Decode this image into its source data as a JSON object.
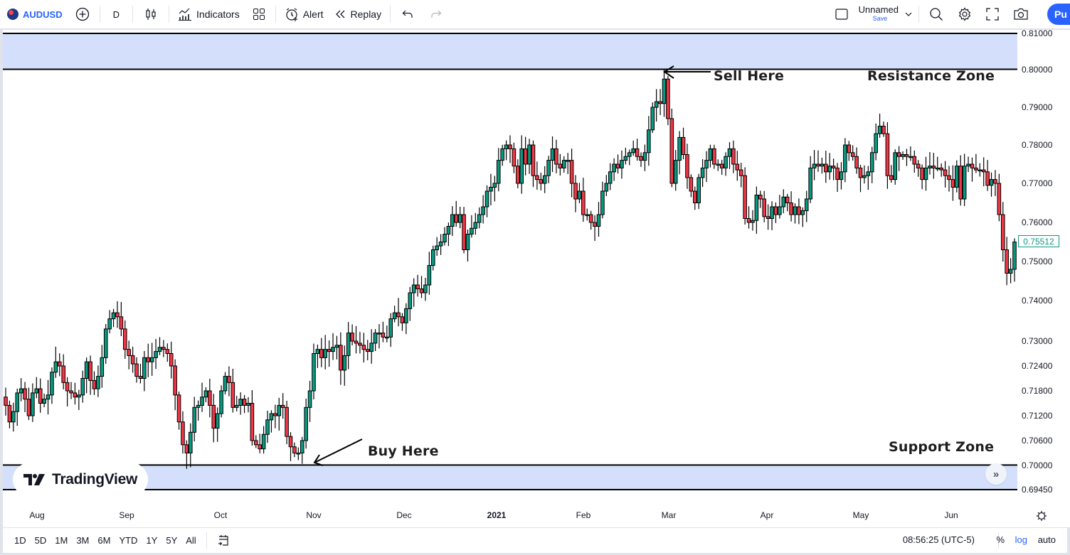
{
  "topbar": {
    "symbol": "AUDUSD",
    "interval": "D",
    "indicators_label": "Indicators",
    "alert_label": "Alert",
    "replay_label": "Replay",
    "layout_name": "Unnamed",
    "layout_save": "Save",
    "publish_label": "Pu",
    "icons": [
      "flag-icon",
      "add-symbol-icon",
      "candle-type-icon",
      "indicators-icon",
      "templates-icon",
      "alert-icon",
      "replay-icon",
      "undo-icon",
      "redo-icon",
      "layout-square-icon",
      "chevron-down-icon",
      "search-icon",
      "settings-icon",
      "fullscreen-icon",
      "camera-icon"
    ]
  },
  "annotations": {
    "sell": "Sell Here",
    "buy": "Buy Here",
    "resistance": "Resistance Zone",
    "support": "Support Zone",
    "logo": "TradingView"
  },
  "price_axis": {
    "last_price": "0.75512",
    "last_price_color": "#089981"
  },
  "bottombar": {
    "ranges": [
      "1D",
      "5D",
      "1M",
      "3M",
      "6M",
      "YTD",
      "1Y",
      "5Y",
      "All"
    ],
    "clock": "08:56:25 (UTC-5)",
    "percent": "%",
    "log": "log",
    "auto": "auto"
  },
  "colors": {
    "up": "#089981",
    "down": "#f23645",
    "zone": "#d4e0fb",
    "accent": "#2962ff"
  },
  "chart_data": {
    "type": "candlestick",
    "title": "AUDUSD D",
    "scale": "log",
    "y_ticks": [
      "0.81000",
      "0.80000",
      "0.79000",
      "0.78000",
      "0.77000",
      "0.76000",
      "0.75000",
      "0.74000",
      "0.73000",
      "0.72400",
      "0.71800",
      "0.71200",
      "0.70600",
      "0.70000",
      "0.69450"
    ],
    "y_tick_values": [
      0.81,
      0.8,
      0.79,
      0.78,
      0.77,
      0.76,
      0.75,
      0.74,
      0.73,
      0.724,
      0.718,
      0.712,
      0.706,
      0.7,
      0.6945
    ],
    "x_ticks": [
      "Aug",
      "Sep",
      "Oct",
      "Nov",
      "Dec",
      "2021",
      "Feb",
      "Mar",
      "Apr",
      "May",
      "Jun"
    ],
    "x_tick_candle_index": [
      7,
      29,
      51,
      74,
      96,
      118,
      140,
      160,
      183,
      206,
      228
    ],
    "zones": [
      {
        "name": "Resistance Zone",
        "low": 0.8001,
        "high": 0.81
      },
      {
        "name": "Support Zone",
        "low": 0.6945,
        "high": 0.7001
      }
    ],
    "last_price": 0.75512,
    "closes": [
      0.7145,
      0.7105,
      0.713,
      0.7175,
      0.7185,
      0.716,
      0.712,
      0.7175,
      0.7185,
      0.715,
      0.716,
      0.717,
      0.7225,
      0.725,
      0.724,
      0.72,
      0.718,
      0.7175,
      0.7165,
      0.717,
      0.721,
      0.725,
      0.7205,
      0.7185,
      0.7215,
      0.726,
      0.733,
      0.7355,
      0.737,
      0.736,
      0.733,
      0.728,
      0.7265,
      0.7245,
      0.7215,
      0.721,
      0.726,
      0.725,
      0.726,
      0.7275,
      0.7285,
      0.728,
      0.727,
      0.724,
      0.717,
      0.7105,
      0.705,
      0.703,
      0.708,
      0.714,
      0.7145,
      0.7165,
      0.718,
      0.7145,
      0.709,
      0.7125,
      0.718,
      0.7215,
      0.72,
      0.714,
      0.7145,
      0.716,
      0.7145,
      0.715,
      0.706,
      0.705,
      0.704,
      0.7075,
      0.711,
      0.7125,
      0.712,
      0.7145,
      0.714,
      0.707,
      0.7045,
      0.703,
      0.703,
      0.706,
      0.714,
      0.718,
      0.727,
      0.728,
      0.726,
      0.728,
      0.7275,
      0.7285,
      0.729,
      0.723,
      0.7265,
      0.732,
      0.73,
      0.7295,
      0.729,
      0.728,
      0.7275,
      0.7295,
      0.732,
      0.732,
      0.731,
      0.731,
      0.7355,
      0.737,
      0.736,
      0.7345,
      0.738,
      0.742,
      0.744,
      0.743,
      0.742,
      0.744,
      0.749,
      0.753,
      0.754,
      0.755,
      0.757,
      0.759,
      0.762,
      0.76,
      0.762,
      0.753,
      0.757,
      0.7585,
      0.76,
      0.762,
      0.764,
      0.768,
      0.769,
      0.77,
      0.776,
      0.779,
      0.78,
      0.779,
      0.7745,
      0.77,
      0.779,
      0.775,
      0.78,
      0.772,
      0.771,
      0.77,
      0.772,
      0.776,
      0.779,
      0.775,
      0.774,
      0.776,
      0.776,
      0.77,
      0.766,
      0.768,
      0.762,
      0.762,
      0.76,
      0.759,
      0.762,
      0.768,
      0.77,
      0.773,
      0.775,
      0.774,
      0.776,
      0.777,
      0.778,
      0.779,
      0.777,
      0.776,
      0.778,
      0.784,
      0.79,
      0.7915,
      0.791,
      0.7975,
      0.787,
      0.77,
      0.776,
      0.782,
      0.7775,
      0.7715,
      0.768,
      0.765,
      0.7715,
      0.774,
      0.776,
      0.779,
      0.775,
      0.775,
      0.774,
      0.777,
      0.779,
      0.775,
      0.7735,
      0.772,
      0.761,
      0.76,
      0.7605,
      0.767,
      0.766,
      0.7615,
      0.761,
      0.764,
      0.762,
      0.764,
      0.7665,
      0.765,
      0.762,
      0.764,
      0.762,
      0.763,
      0.766,
      0.774,
      0.775,
      0.7745,
      0.775,
      0.773,
      0.7745,
      0.774,
      0.771,
      0.773,
      0.78,
      0.778,
      0.777,
      0.774,
      0.7715,
      0.772,
      0.773,
      0.778,
      0.783,
      0.785,
      0.783,
      0.772,
      0.771,
      0.778,
      0.777,
      0.7775,
      0.777,
      0.777,
      0.775,
      0.774,
      0.771,
      0.774,
      0.7745,
      0.774,
      0.774,
      0.7735,
      0.772,
      0.771,
      0.769,
      0.7745,
      0.766,
      0.7745,
      0.775,
      0.774,
      0.7735,
      0.7735,
      0.773,
      0.7695,
      0.771,
      0.77,
      0.762,
      0.753,
      0.747,
      0.748,
      0.755
    ]
  }
}
